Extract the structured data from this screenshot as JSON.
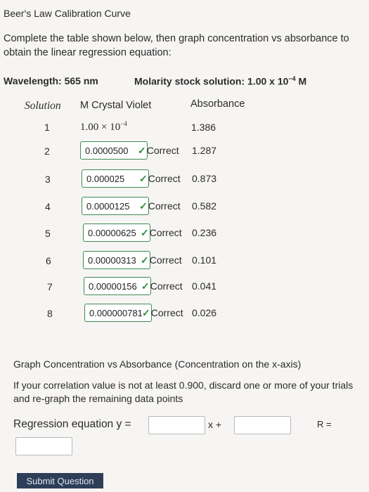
{
  "title": "Beer's Law Calibration Curve",
  "intro": "Complete the table shown below, then graph concentration vs absorbance to obtain the linear regression equation:",
  "wavelength": "Wavelength: 565 nm",
  "molarity_prefix": "Molarity stock solution: 1.00 x 10",
  "molarity_exp": "−4",
  "molarity_unit": " M",
  "table": {
    "header_solution": "Solution",
    "header_m": "M Crystal Violet",
    "header_abs": "Absorbance",
    "stock_num": "1",
    "stock_base": "1.00 × 10",
    "stock_exp": "−4",
    "stock_abs": "1.386",
    "rows": [
      {
        "num": "2",
        "value": "0.0000500",
        "status": "Correct",
        "abs": "1.287"
      },
      {
        "num": "3",
        "value": "0.000025",
        "status": "Correct",
        "abs": "0.873"
      },
      {
        "num": "4",
        "value": "0.0000125",
        "status": "Correct",
        "abs": "0.582"
      },
      {
        "num": "5",
        "value": "0.00000625",
        "status": "Correct",
        "abs": "0.236"
      },
      {
        "num": "6",
        "value": "0.00000313",
        "status": "Correct",
        "abs": "0.101"
      },
      {
        "num": "7",
        "value": "0.00000156",
        "status": "Correct",
        "abs": "0.041"
      },
      {
        "num": "8",
        "value": "0.000000781",
        "status": "Correct",
        "abs": "0.026"
      }
    ]
  },
  "graph_instruction": "Graph Concentration vs Absorbance (Concentration on the x-axis)",
  "correlation_note": "If your correlation value is not at least 0.900, discard one or more of your trials and re-graph the remaining data points",
  "regression_label": "Regression equation  y =",
  "x_plus": "x  +",
  "r_label": "R =",
  "inputs": {
    "slope": "",
    "intercept": "",
    "r": ""
  },
  "submit_label": "Submit Question",
  "check_glyph": "✓",
  "colors": {
    "correct": "#2e8b3c",
    "field_border": "#3f8a52",
    "submit_bg": "#2e3e58"
  }
}
